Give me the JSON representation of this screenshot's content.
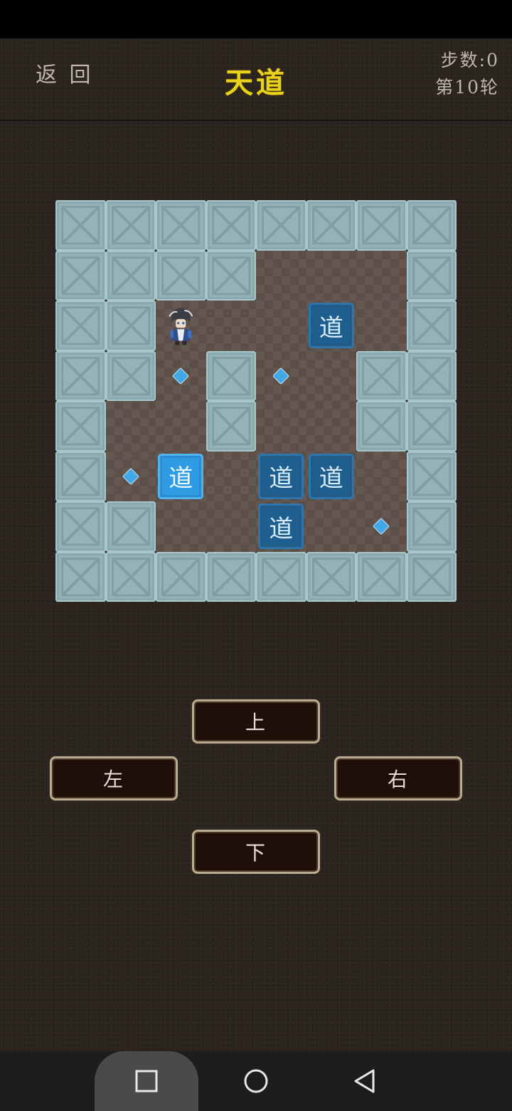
{
  "header": {
    "back_label": "返 回",
    "title": "天道",
    "steps_label": "步数:0",
    "round_label": "第10轮"
  },
  "board": {
    "rows": 8,
    "cols": 8,
    "grid": [
      "########",
      "####...#",
      "##@..B.#",
      "##.#..##",
      "#..#..##",
      "#.b.BB.#",
      "##..B..#",
      "########"
    ],
    "targets": [
      [
        3,
        2
      ],
      [
        3,
        4
      ],
      [
        5,
        1
      ],
      [
        6,
        6
      ]
    ],
    "boxes": [
      {
        "row": 2,
        "col": 5,
        "label": "道",
        "on_target": true
      },
      {
        "row": 5,
        "col": 2,
        "label": "道",
        "on_target": false
      },
      {
        "row": 5,
        "col": 4,
        "label": "道",
        "on_target": true
      },
      {
        "row": 5,
        "col": 5,
        "label": "道",
        "on_target": true
      },
      {
        "row": 6,
        "col": 4,
        "label": "道",
        "on_target": true
      }
    ],
    "player": {
      "row": 2,
      "col": 2
    }
  },
  "controls": {
    "up": "上",
    "left": "左",
    "right": "右",
    "down": "下"
  },
  "colors": {
    "title": "#e9d21c",
    "wall": "#93b3b8",
    "floor": "#655850",
    "box_on_target": "#1f5f90",
    "box_off_target": "#2f9be2",
    "target": "#43a8e6"
  },
  "nav": {
    "icons": [
      "recent-apps-icon",
      "home-icon",
      "back-icon"
    ]
  }
}
